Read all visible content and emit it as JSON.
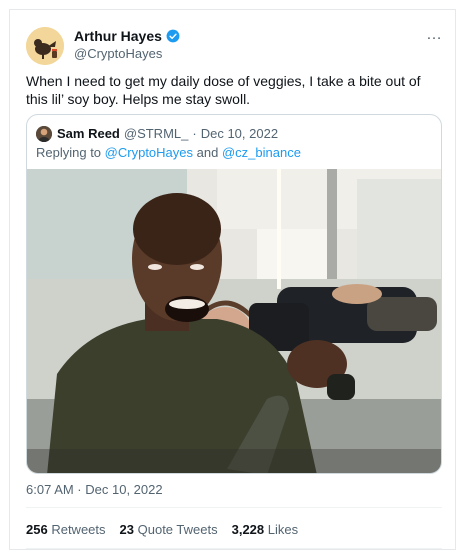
{
  "author": {
    "display_name": "Arthur Hayes",
    "handle": "@CryptoHayes",
    "verified": true,
    "avatar_icon": "bird-avatar-icon"
  },
  "more_icon": "…",
  "tweet": {
    "text": "When I need to get my daily dose of veggies, I take a bite out of this lil’ soy boy. Helps me stay swoll."
  },
  "quoted": {
    "display_name": "Sam Reed",
    "handle": "@STRML_",
    "separator": "·",
    "date": "Dec 10, 2022",
    "replying_prefix": "Replying to",
    "reply_user_1": "@CryptoHayes",
    "reply_conj": "and",
    "reply_user_2": "@cz_binance",
    "photo": "photo-man-with-cutout"
  },
  "timestamp": "6:07 AM · Dec 10, 2022",
  "stats": {
    "retweets": {
      "count": "256",
      "label": "Retweets"
    },
    "quotes": {
      "count": "23",
      "label": "Quote Tweets"
    },
    "likes": {
      "count": "3,228",
      "label": "Likes"
    }
  },
  "colors": {
    "link": "#1d9bf0",
    "secondary_text": "#536471",
    "verified": "#1d9bf0"
  }
}
